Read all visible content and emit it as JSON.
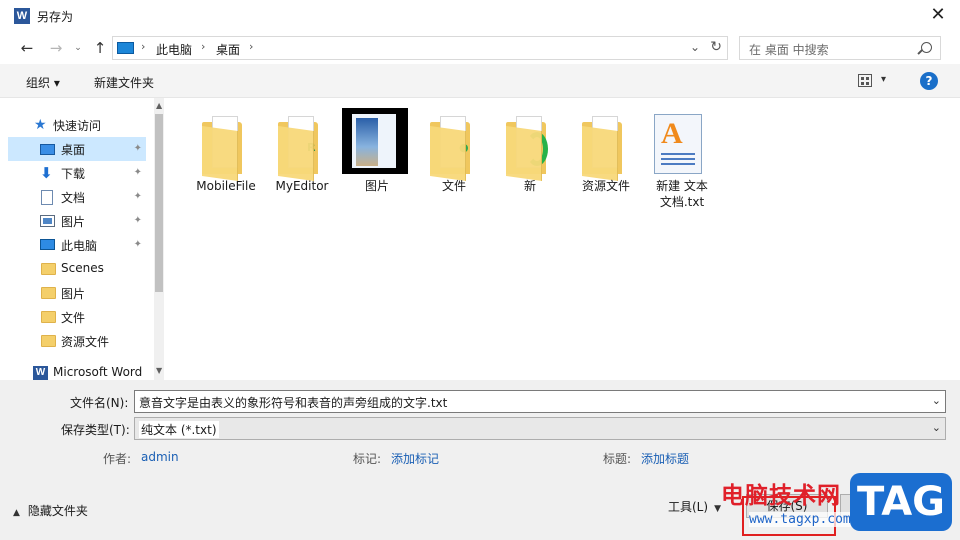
{
  "window": {
    "title": "另存为",
    "app_icon": "word-icon",
    "close_glyph": "✕"
  },
  "nav": {
    "back": "←",
    "forward": "→",
    "dropdown": "⌄",
    "up": "↑",
    "breadcrumbs": [
      "此电脑",
      "桌面"
    ],
    "separator": "›",
    "address_dropdown": "⌄",
    "refresh": "↻"
  },
  "search": {
    "placeholder": "在 桌面 中搜索"
  },
  "toolbar": {
    "organize": "组织 ▾",
    "new_folder": "新建文件夹",
    "view_dd": "▾",
    "help": "?"
  },
  "sidebar": {
    "items": [
      {
        "label": "快速访问",
        "icon": "star-icon"
      },
      {
        "label": "桌面",
        "icon": "desktop-icon",
        "pinned": true,
        "selected": true
      },
      {
        "label": "下载",
        "icon": "download-icon",
        "pinned": true
      },
      {
        "label": "文档",
        "icon": "document-icon",
        "pinned": true
      },
      {
        "label": "图片",
        "icon": "pictures-icon",
        "pinned": true
      },
      {
        "label": "此电脑",
        "icon": "computer-icon",
        "pinned": true
      },
      {
        "label": "Scenes",
        "icon": "folder-icon"
      },
      {
        "label": "图片",
        "icon": "folder-icon"
      },
      {
        "label": "文件",
        "icon": "folder-icon"
      },
      {
        "label": "资源文件",
        "icon": "folder-icon"
      },
      {
        "label": "Microsoft Word",
        "icon": "word-icon"
      }
    ],
    "pin_glyph": "📌"
  },
  "files": [
    {
      "label": "MobileFile",
      "kind": "folder"
    },
    {
      "label": "MyEditor",
      "kind": "folder"
    },
    {
      "label": "图片",
      "kind": "picture-folder"
    },
    {
      "label": "文件",
      "kind": "folder"
    },
    {
      "label": "新",
      "kind": "folder"
    },
    {
      "label": "资源文件",
      "kind": "folder"
    },
    {
      "label": "新建 文本\n文档.txt",
      "kind": "text-file"
    }
  ],
  "form": {
    "filename_label": "文件名(N):",
    "filename_value": "意音文字是由表义的象形符号和表音的声旁组成的文字.txt",
    "type_label": "保存类型(T):",
    "type_value": "纯文本 (*.txt)",
    "author_label": "作者:",
    "author_value": "admin",
    "tags_label": "标记:",
    "tags_value": "添加标记",
    "title_label": "标题:",
    "title_value": "添加标题"
  },
  "footer": {
    "hide_folders": "隐藏文件夹",
    "tools": "工具(L)",
    "save": "保存(S)"
  },
  "watermark": {
    "text": "电脑技术网",
    "url": "www.tagxp.com",
    "badge": "TAG"
  }
}
